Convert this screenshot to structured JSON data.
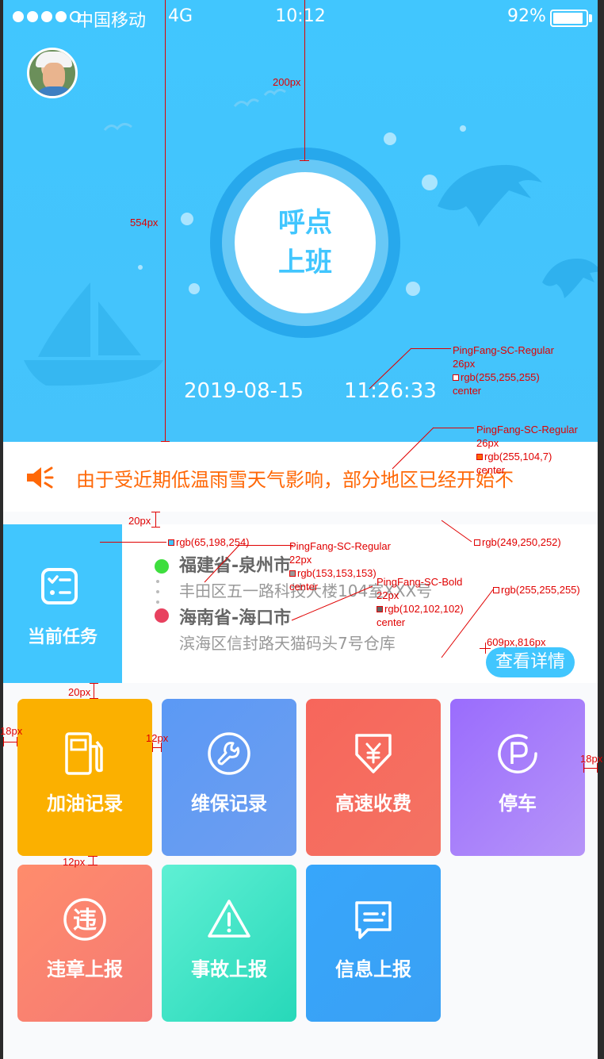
{
  "status_bar": {
    "carrier": "中国移动",
    "network": "4G",
    "time": "10:12",
    "battery_pct": "92%",
    "battery_level": 0.92,
    "signal_bars_filled": 4,
    "signal_bars_total": 5
  },
  "hero": {
    "clock_button": {
      "line1": "呼点",
      "line2": "上班"
    },
    "date": "2019-08-15",
    "time": "11:26:33",
    "colors": {
      "background": "#41c6fe",
      "ring": "#27a8ec"
    }
  },
  "notice": {
    "icon": "speaker-icon",
    "text": "由于受近期低温雨雪天气影响，部分地区已经开始不",
    "color": "#ff6807"
  },
  "task": {
    "side_label": "当前任务",
    "side_icon": "task-list-icon",
    "origin": {
      "title": "福建省-泉州市",
      "address": "丰田区五一路科技大楼104室XXX号",
      "dot_color": "#3ede3e"
    },
    "destination": {
      "title": "海南省-海口市",
      "address": "滨海区信封路天猫码头7号仓库",
      "dot_color": "#e8415f"
    },
    "detail_button": "查看详情"
  },
  "tiles": [
    {
      "label": "加油记录",
      "icon": "fuel-pump-icon",
      "colors": [
        "#fbb000",
        "#fbb000"
      ]
    },
    {
      "label": "维保记录",
      "icon": "wrench-icon",
      "colors": [
        "#5b99f5",
        "#6e9ef0"
      ]
    },
    {
      "label": "高速收费",
      "icon": "toll-yen-icon",
      "colors": [
        "#f7665b",
        "#f47363"
      ]
    },
    {
      "label": "停车",
      "icon": "parking-icon",
      "colors": [
        "#9a6cfd",
        "#b694f8"
      ]
    },
    {
      "label": "违章上报",
      "icon": "violation-icon",
      "colors": [
        "#ff8c6c",
        "#f57a74"
      ]
    },
    {
      "label": "事故上报",
      "icon": "warning-triangle-icon",
      "colors": [
        "#5ff0d4",
        "#27d8b9"
      ]
    },
    {
      "label": "信息上报",
      "icon": "message-icon",
      "colors": [
        "#37a6fb",
        "#3aa0f4"
      ]
    }
  ],
  "annotations": {
    "dim_200": "200px",
    "dim_554": "554px",
    "spec_time": [
      "PingFang-SC-Regular",
      "26px",
      "rgb(255,255,255)",
      "center"
    ],
    "spec_notice": [
      "PingFang-SC-Regular",
      "26px",
      "rgb(255,104,7)",
      "center"
    ],
    "dim_20_a": "20px",
    "color_side": "rgb(65,198,254)",
    "color_bg": "rgb(249,250,252)",
    "spec_addr": [
      "PingFang-SC-Regular",
      "22px",
      "rgb(153,153,153)",
      "center"
    ],
    "spec_title": [
      "PingFang-SC-Bold",
      "22px",
      "rgb(102,102,102)",
      "center"
    ],
    "color_card": "rgb(255,255,255)",
    "coord": "609px,816px",
    "dim_20_b": "20px",
    "dim_18_l": "18px",
    "dim_12_gap": "12px",
    "dim_18_r": "18px",
    "dim_12_row": "12px"
  }
}
